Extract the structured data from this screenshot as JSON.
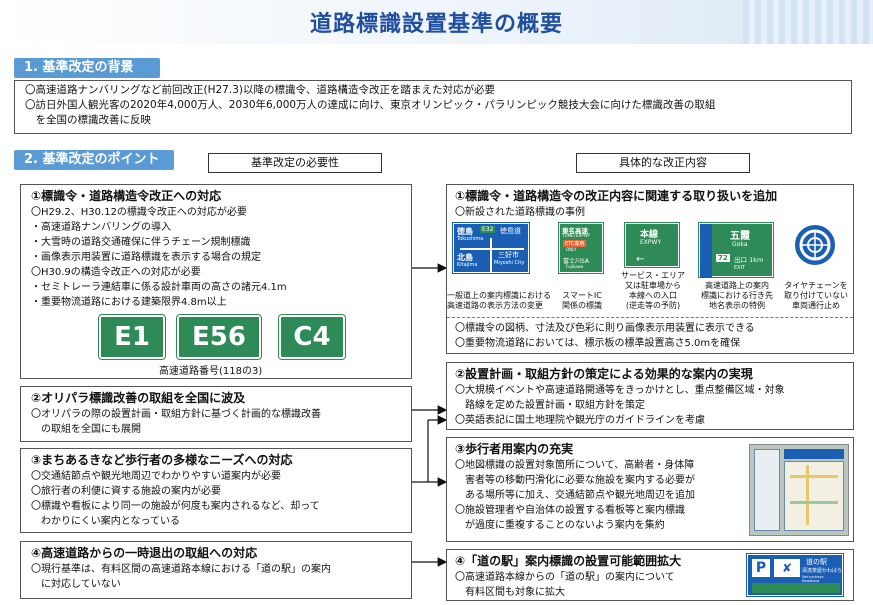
{
  "title": "道路標識設置基準の概要",
  "sec1": {
    "label": "1. 基準改定の背景",
    "lines": [
      "〇高速道路ナンバリングなど前回改正(H27.3)以降の標識令、道路構造令改正を踏まえた対応が必要",
      "〇訪日外国人観光客の2020年4,000万人、2030年6,000万人の達成に向け、東京オリンピック・パラリンピック競技大会に向けた標識改善の取組",
      "　を全国の標識改善に反映"
    ]
  },
  "sec2": {
    "label": "2. 基準改定のポイント",
    "left_header": "基準改定の必要性",
    "right_header": "具体的な改正内容"
  },
  "left": [
    {
      "title": "①標識令・道路構造令改正への対応",
      "lines": [
        "〇H29.2、H30.12の標識令改正への対応が必要",
        "・高速道路ナンバリングの導入",
        "・大雪時の道路交通確保に伴うチェーン規制標識",
        "・画像表示用装置に道路標識を表示する場合の規定",
        "〇H30.9の構造令改正への対応が必要",
        "・セミトレーラ連結車に係る設計車両の高さの諸元4.1m",
        "・重要物流道路における建築限界4.8m以上"
      ],
      "signs": [
        "E1",
        "E56",
        "C4"
      ],
      "signs_caption": "高速道路番号(118の3)"
    },
    {
      "title": "②オリパラ標識改善の取組を全国に波及",
      "lines": [
        "〇オリパラの際の設置計画・取組方針に基づく計画的な標識改善",
        "　の取組を全国にも展開"
      ]
    },
    {
      "title": "③まちあるきなど歩行者の多様なニーズへの対応",
      "lines": [
        "〇交通結節点や観光地周辺でわかりやすい道案内が必要",
        "〇旅行者の利便に資する施設の案内が必要",
        "〇標識や看板により同一の施設が何度も案内されるなど、却って",
        "　わかりにくい案内となっている"
      ]
    },
    {
      "title": "④高速道路からの一時退出の取組への対応",
      "lines": [
        "〇現行基準は、有料区間の高速道路本線における「道の駅」の案内",
        "　に対応していない"
      ]
    }
  ],
  "right": [
    {
      "title": "①標識令・道路構造令の改正内容に関連する取り扱いを追加",
      "sub": "〇新設された道路標識の事例",
      "examples": [
        {
          "caption1": "一般道上の案内標識における",
          "caption2": "高速道路の表示方法の変更",
          "texts": [
            "徳島",
            "E32",
            "徳島道",
            "Tokushima",
            "北島",
            "Kitajima",
            "三好市",
            "Miyoshi City"
          ]
        },
        {
          "caption1": "スマートIC",
          "caption2": "関係の標識",
          "texts": [
            "東名高速",
            "TOMEI EXPWY",
            "ETC専用",
            "ONLY",
            "富士川SA",
            "Fujikawa"
          ]
        },
        {
          "caption1": "サービス・エリア",
          "caption2": "又は駐車場から",
          "caption3": "本線への入口",
          "caption4": "(逆走等の予防)",
          "texts": [
            "本線",
            "EXPWY"
          ]
        },
        {
          "caption1": "高速道路上の案内",
          "caption2": "標識における行き先",
          "caption3": "地名表示の特例",
          "texts": [
            "五霞",
            "Goka",
            "72",
            "出口 1km",
            "EXIT"
          ]
        },
        {
          "caption1": "タイヤチェーンを",
          "caption2": "取り付けていない",
          "caption3": "車両通行止め",
          "texts": []
        }
      ],
      "lines": [
        "〇標識令の図柄、寸法及び色彩に則り画像表示用装置に表示できる",
        "〇重要物流道路においては、標示板の標準設置高さ5.0mを確保"
      ]
    },
    {
      "title": "②設置計画・取組方針の策定による効果的な案内の実現",
      "lines": [
        "〇大規模イベントや高速道路開通等をきっかけとし、重点整備区域・対象",
        "　路線を定めた設置計画・取組方針を策定",
        "〇英語表記に国土地理院や観光庁のガイドラインを考慮"
      ]
    },
    {
      "title": "③歩行者用案内の充実",
      "lines": [
        "〇地図標識の設置対象箇所について、高齢者・身体障",
        "　害者等の移動円滑化に必要な施設を案内する必要が",
        "　ある場所等に加え、交通結節点や観光地周辺を追加",
        "〇施設管理者や自治体の設置する看板等と案内標識",
        "　が過度に重複することのないよう案内を集約"
      ]
    },
    {
      "title": "④「道の駅」案内標識の設置可能範囲拡大",
      "lines": [
        "〇高速道路本線からの「道の駅」の案内について",
        "　有料区間も対象に拡大"
      ],
      "sign_texts": [
        "P",
        "道の駅",
        "清流茶屋かわばら",
        "Seiryuchaya Kawabara"
      ]
    }
  ],
  "colors": {
    "accent": "#1f4e9c",
    "label_bg": "#5b9bd5",
    "sign_green": "#2e8b57",
    "sign_blue": "#1a5fb4"
  }
}
